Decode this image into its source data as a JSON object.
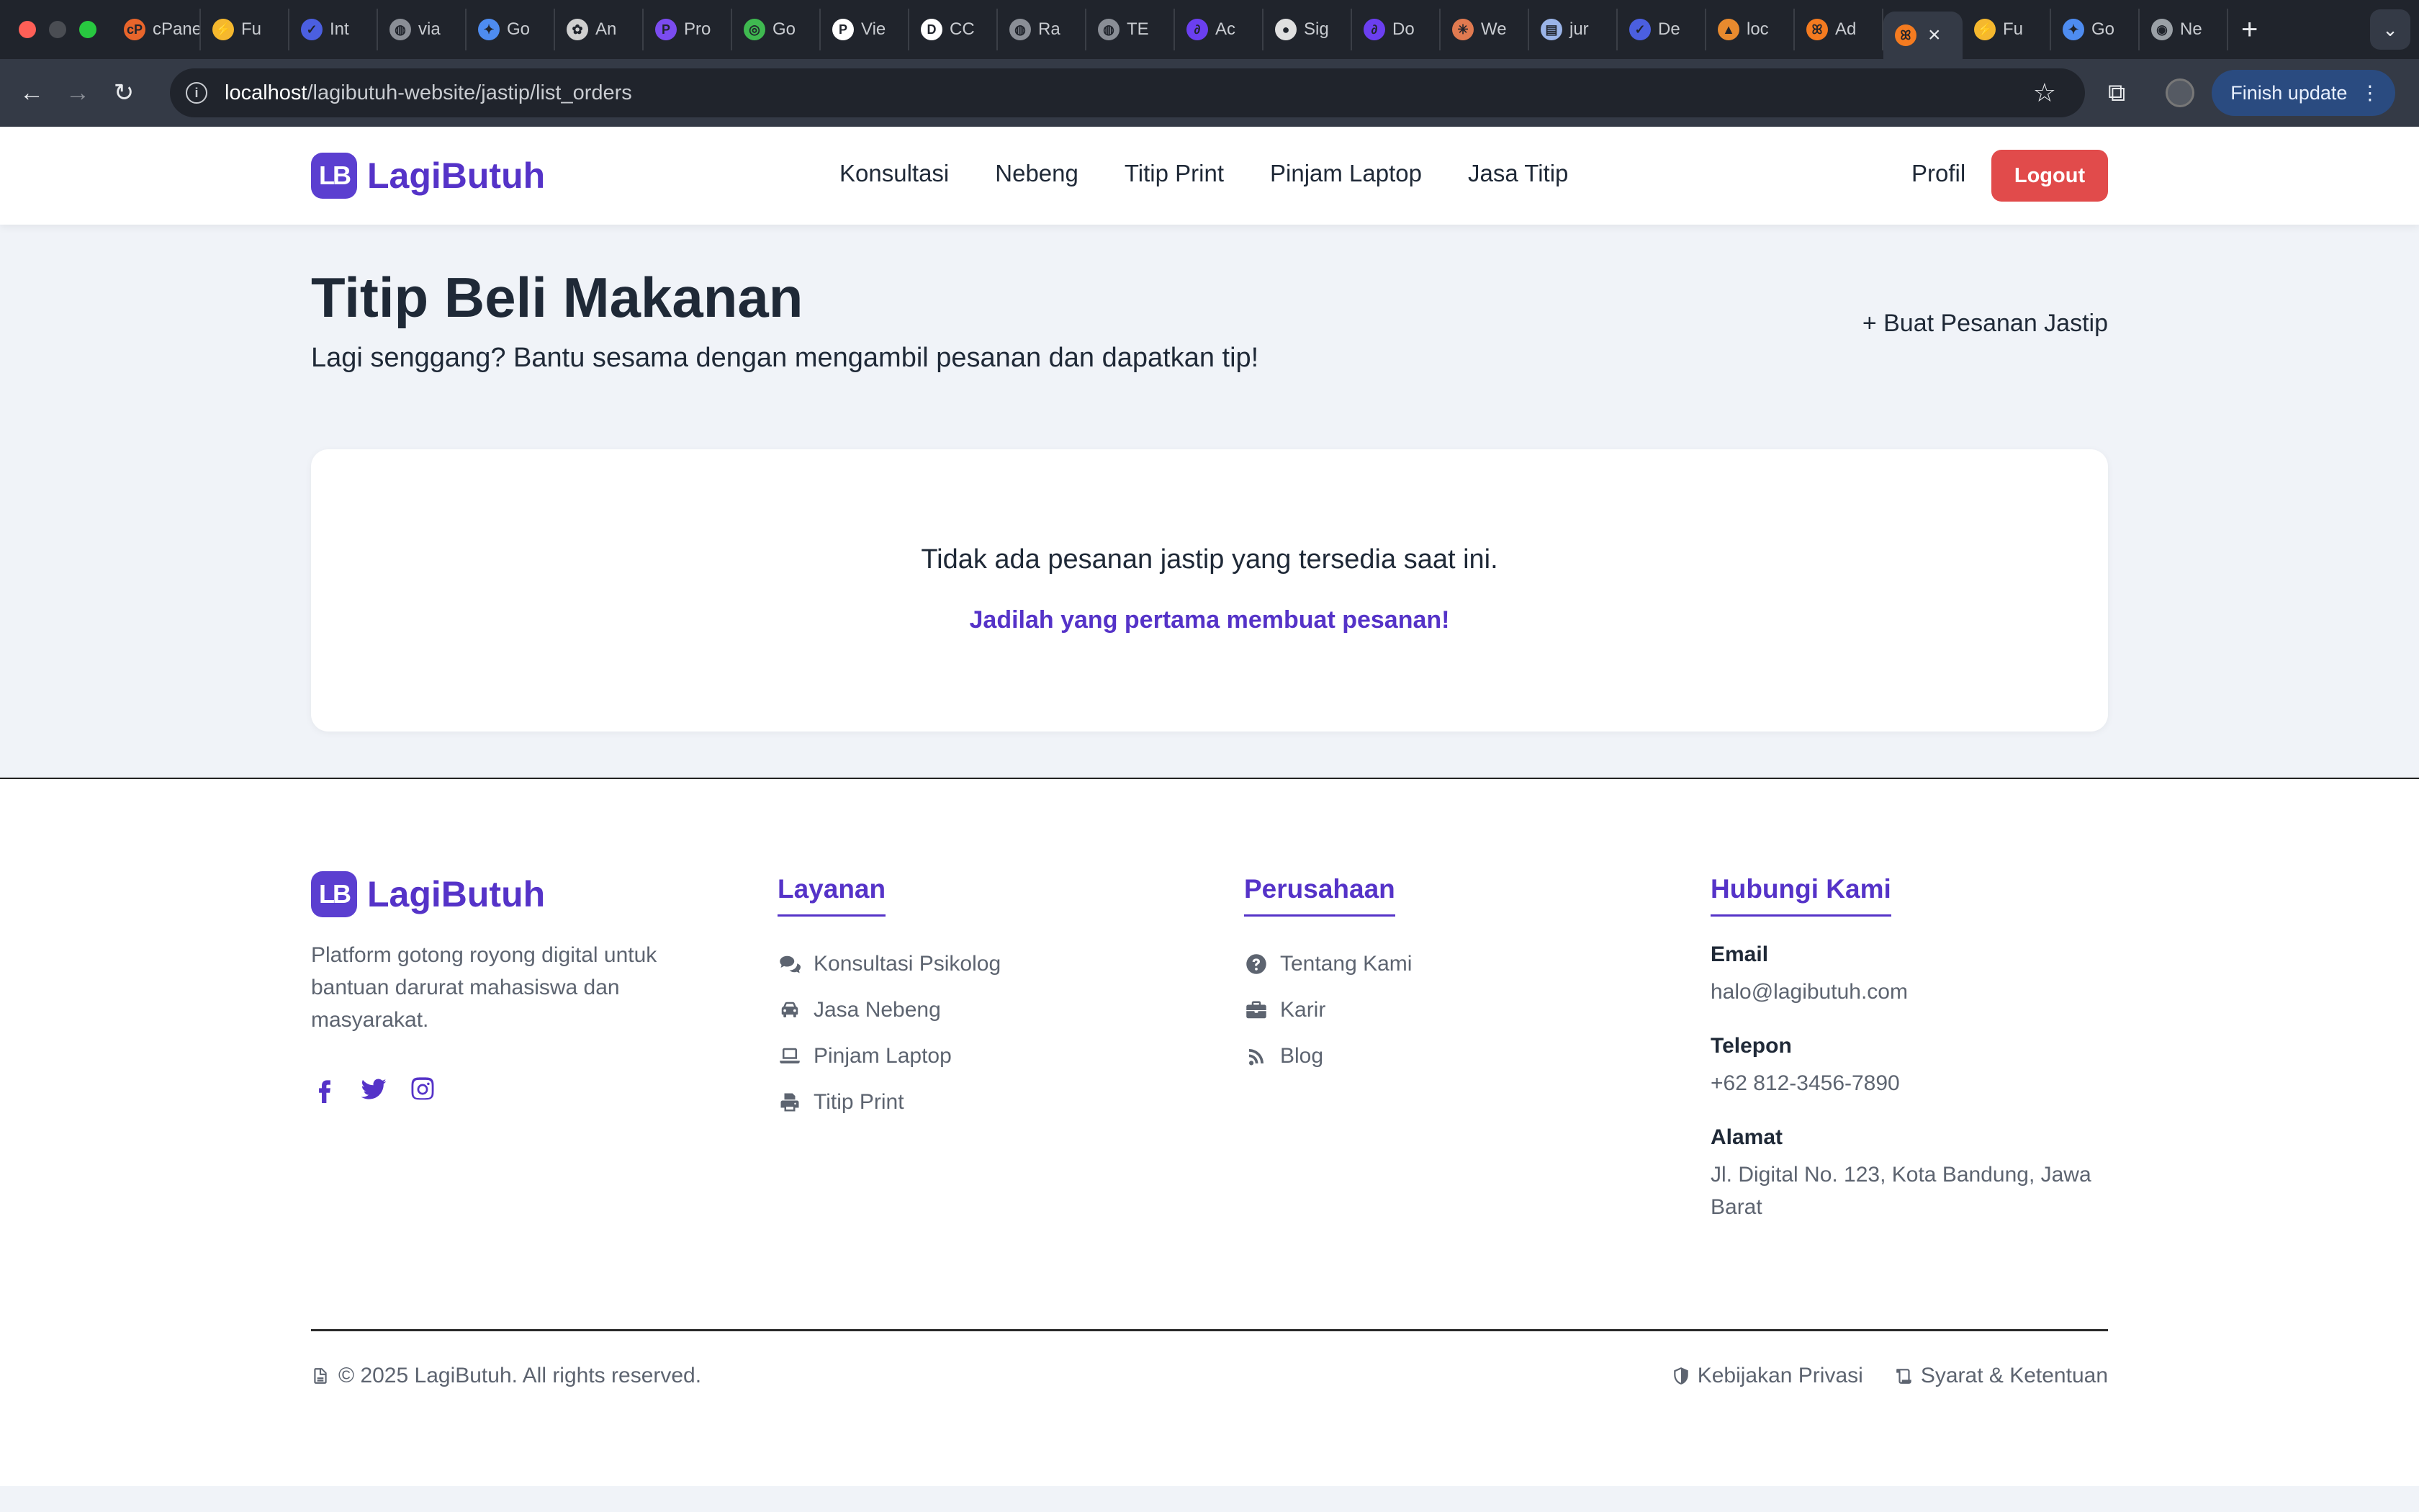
{
  "browser": {
    "tabs": [
      {
        "label": "cPanel",
        "icon": "cpanel-icon",
        "color": "#e8652b"
      },
      {
        "label": "Fu",
        "icon": "bolt-icon",
        "color": "#f5b82e"
      },
      {
        "label": "Int",
        "icon": "dev-icon",
        "color": "#4b5fe0"
      },
      {
        "label": "via",
        "icon": "globe-icon",
        "color": "#8a8e96"
      },
      {
        "label": "Go",
        "icon": "sparkle-icon",
        "color": "#4e8cf0"
      },
      {
        "label": "An",
        "icon": "openai-icon",
        "color": "#d0d0d0"
      },
      {
        "label": "Pro",
        "icon": "p-icon",
        "color": "#7b4cf0"
      },
      {
        "label": "Go",
        "icon": "circle-icon",
        "color": "#3fb950"
      },
      {
        "label": "Vie",
        "icon": "pkp-icon",
        "color": "#ffffff"
      },
      {
        "label": "CC",
        "icon": "dp-icon",
        "color": "#ffffff"
      },
      {
        "label": "Ra",
        "icon": "globe-icon",
        "color": "#8a8e96"
      },
      {
        "label": "TE",
        "icon": "globe-icon",
        "color": "#8a8e96"
      },
      {
        "label": "Ac",
        "icon": "loop-icon",
        "color": "#6b3ff0"
      },
      {
        "label": "Sig",
        "icon": "github-icon",
        "color": "#e0e0e0"
      },
      {
        "label": "Do",
        "icon": "loop-icon",
        "color": "#6b3ff0"
      },
      {
        "label": "We",
        "icon": "asterisk-icon",
        "color": "#e07a50"
      },
      {
        "label": "jur",
        "icon": "file-icon",
        "color": "#9ab4e8"
      },
      {
        "label": "De",
        "icon": "dev-icon",
        "color": "#4b5fe0"
      },
      {
        "label": "loc",
        "icon": "ship-icon",
        "color": "#e88a2e"
      },
      {
        "label": "Ad",
        "icon": "xampp-icon",
        "color": "#f47b20"
      }
    ],
    "active_tab": {
      "icon": "xampp-icon",
      "color": "#f47b20"
    },
    "trailing_tabs": [
      {
        "label": "Fu",
        "icon": "bolt-icon",
        "color": "#f5b82e"
      },
      {
        "label": "Go",
        "icon": "sparkle-icon",
        "color": "#4e8cf0"
      },
      {
        "label": "Ne",
        "icon": "chrome-icon",
        "color": "#9aa0a6"
      }
    ],
    "url_host": "localhost",
    "url_path": "/lagibutuh-website/jastip/list_orders",
    "finish_update": "Finish update"
  },
  "header": {
    "logo_mark": "LB",
    "logo_text": "LagiButuh",
    "nav": [
      "Konsultasi",
      "Nebeng",
      "Titip Print",
      "Pinjam Laptop",
      "Jasa Titip"
    ],
    "profile": "Profil",
    "logout": "Logout"
  },
  "main": {
    "title": "Titip Beli Makanan",
    "subtitle": "Lagi senggang? Bantu sesama dengan mengambil pesanan dan dapatkan tip!",
    "create_link": "+ Buat Pesanan Jastip",
    "empty_text": "Tidak ada pesanan jastip yang tersedia saat ini.",
    "empty_cta": "Jadilah yang pertama membuat pesanan!"
  },
  "footer": {
    "logo_mark": "LB",
    "logo_text": "LagiButuh",
    "description": "Platform gotong royong digital untuk bantuan darurat mahasiswa dan masyarakat.",
    "layanan": {
      "title": "Layanan",
      "items": [
        {
          "label": "Konsultasi Psikolog",
          "icon": "comments-icon"
        },
        {
          "label": "Jasa Nebeng",
          "icon": "car-icon"
        },
        {
          "label": "Pinjam Laptop",
          "icon": "laptop-icon"
        },
        {
          "label": "Titip Print",
          "icon": "print-icon"
        }
      ]
    },
    "perusahaan": {
      "title": "Perusahaan",
      "items": [
        {
          "label": "Tentang Kami",
          "icon": "question-circle-icon"
        },
        {
          "label": "Karir",
          "icon": "briefcase-icon"
        },
        {
          "label": "Blog",
          "icon": "rss-icon"
        }
      ]
    },
    "kontak": {
      "title": "Hubungi Kami",
      "email_label": "Email",
      "email": "halo@lagibutuh.com",
      "phone_label": "Telepon",
      "phone": "+62 812-3456-7890",
      "address_label": "Alamat",
      "address": "Jl. Digital No. 123, Kota Bandung, Jawa Barat"
    },
    "copyright": "© 2025 LagiButuh. All rights reserved.",
    "privacy": "Kebijakan Privasi",
    "terms": "Syarat & Ketentuan"
  },
  "colors": {
    "brand": "#5533c8",
    "logout": "#e14b4b",
    "page_bg": "#f0f3f8"
  }
}
